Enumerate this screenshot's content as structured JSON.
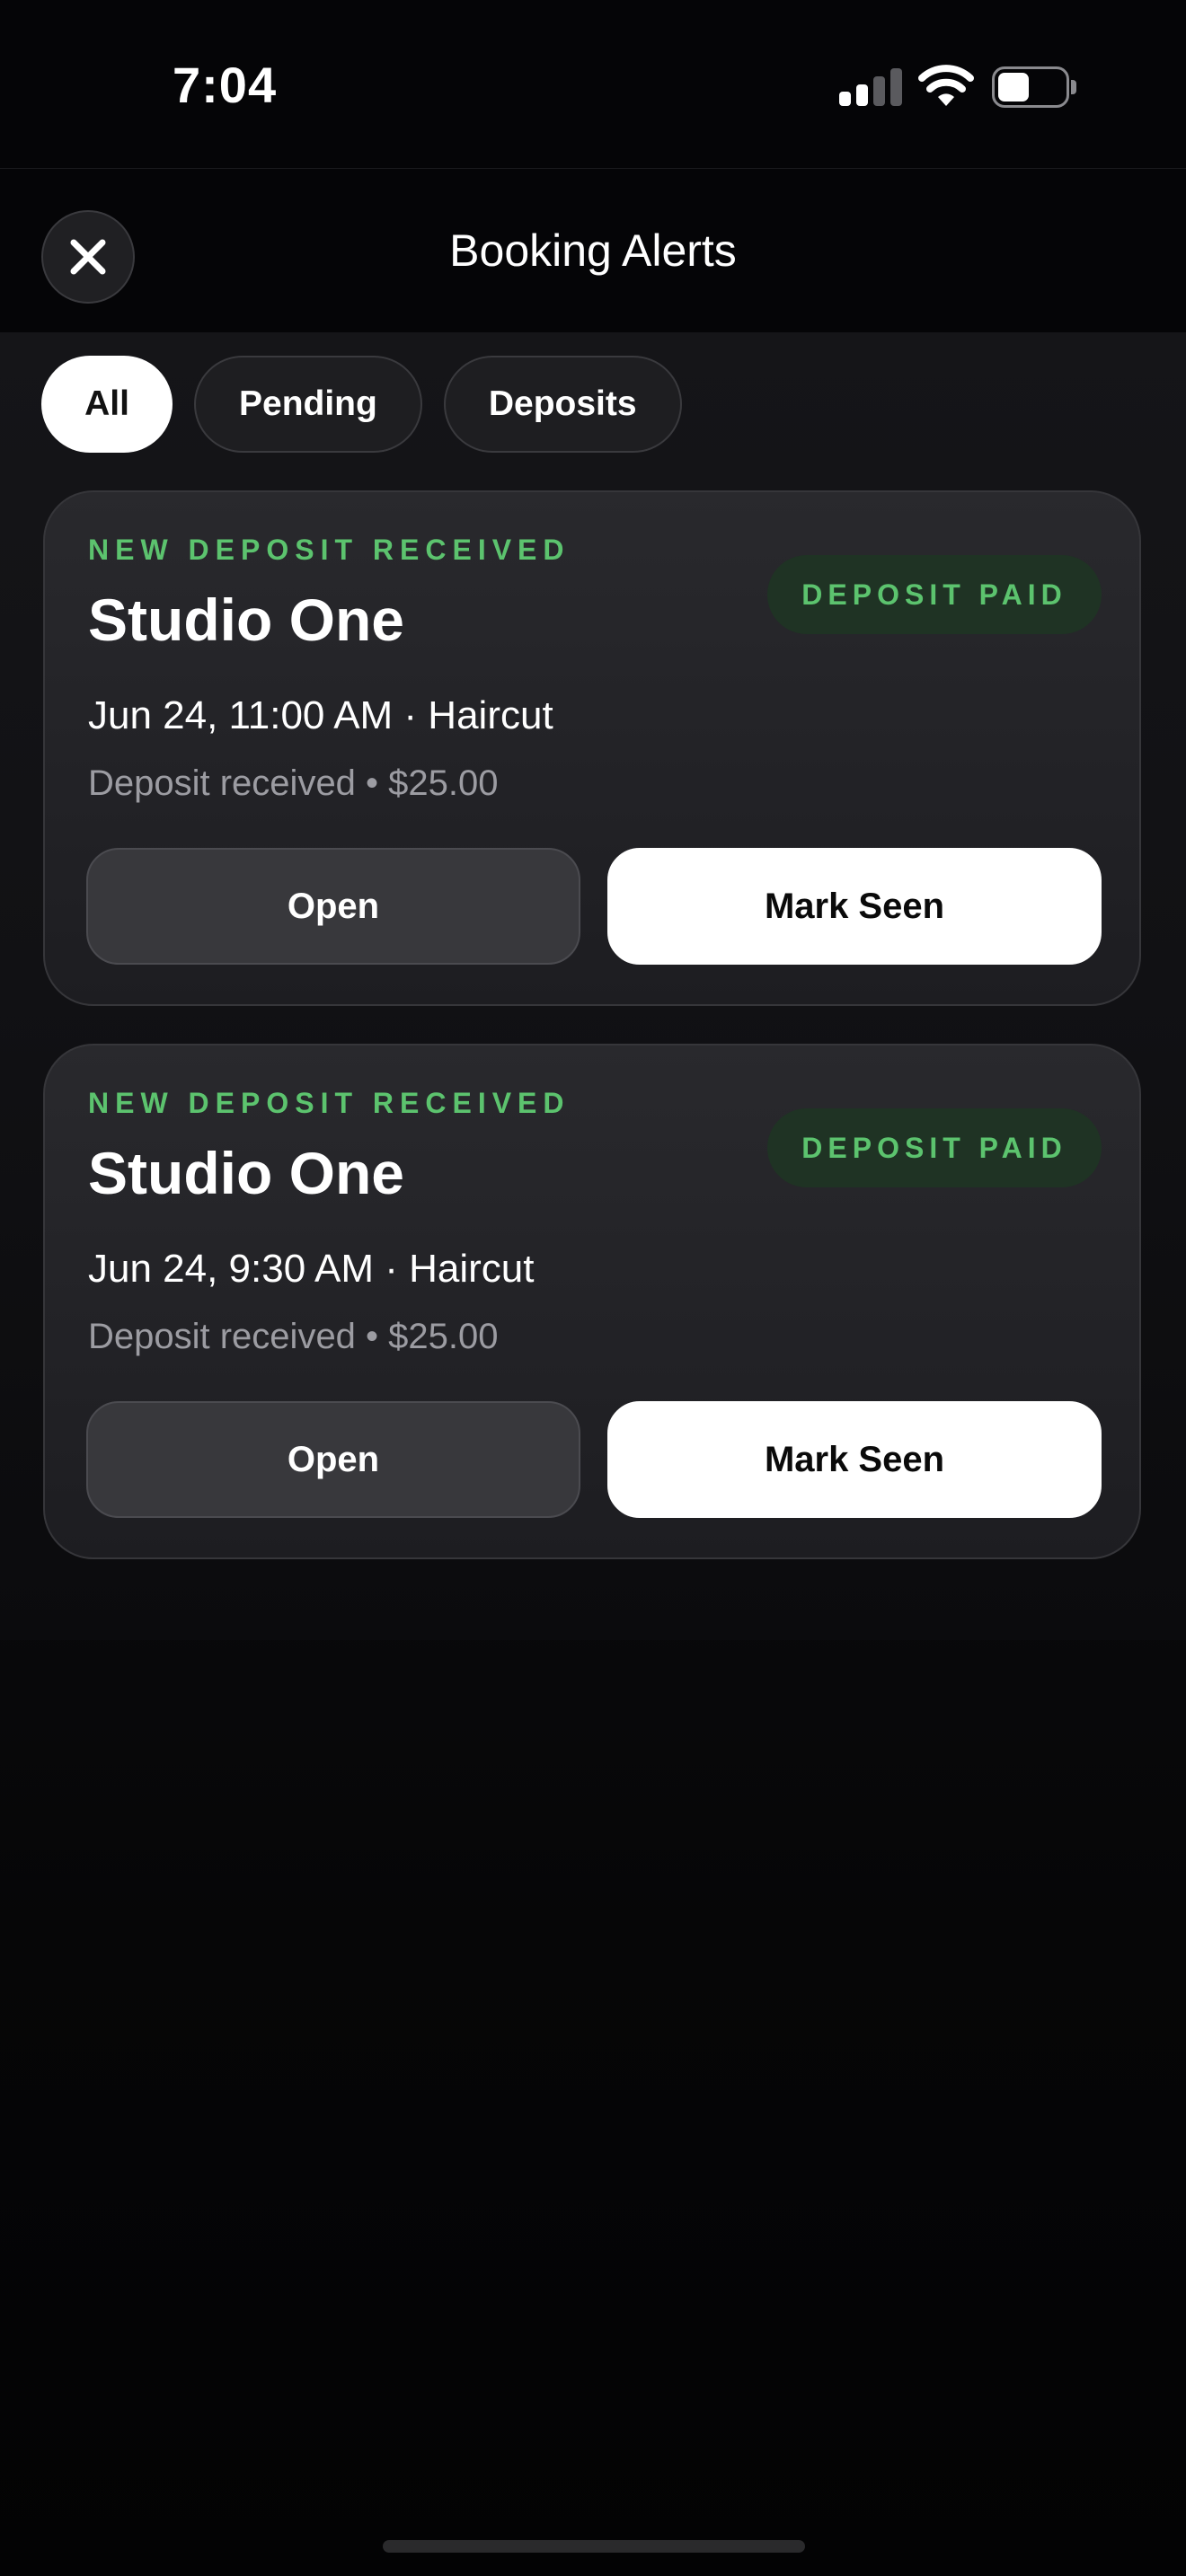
{
  "status_bar": {
    "time": "7:04",
    "icons": [
      "cellular-signal-icon",
      "wifi-icon",
      "battery-icon"
    ],
    "signal_bars_filled": 2,
    "signal_bars_total": 4,
    "battery_level": 0.4
  },
  "header": {
    "title": "Booking Alerts",
    "close_icon": "close-icon"
  },
  "filters": {
    "selected": "All",
    "options": [
      {
        "label": "All"
      },
      {
        "label": "Pending"
      },
      {
        "label": "Deposits"
      }
    ]
  },
  "alerts": [
    {
      "eyebrow": "NEW DEPOSIT RECEIVED",
      "title": "Studio One",
      "badge": "DEPOSIT PAID",
      "when": "Jun 24, 11:00 AM · Haircut",
      "detail": "Deposit received • $25.00",
      "open_label": "Open",
      "seen_label": "Mark Seen"
    },
    {
      "eyebrow": "NEW DEPOSIT RECEIVED",
      "title": "Studio One",
      "badge": "DEPOSIT PAID",
      "when": "Jun 24, 9:30 AM · Haircut",
      "detail": "Deposit received • $25.00",
      "open_label": "Open",
      "seen_label": "Mark Seen"
    }
  ],
  "colors": {
    "accent_green": "#5cc36e",
    "badge_bg": "#1f3324",
    "background": "#0b0b0e",
    "card_bg": "#242428"
  }
}
